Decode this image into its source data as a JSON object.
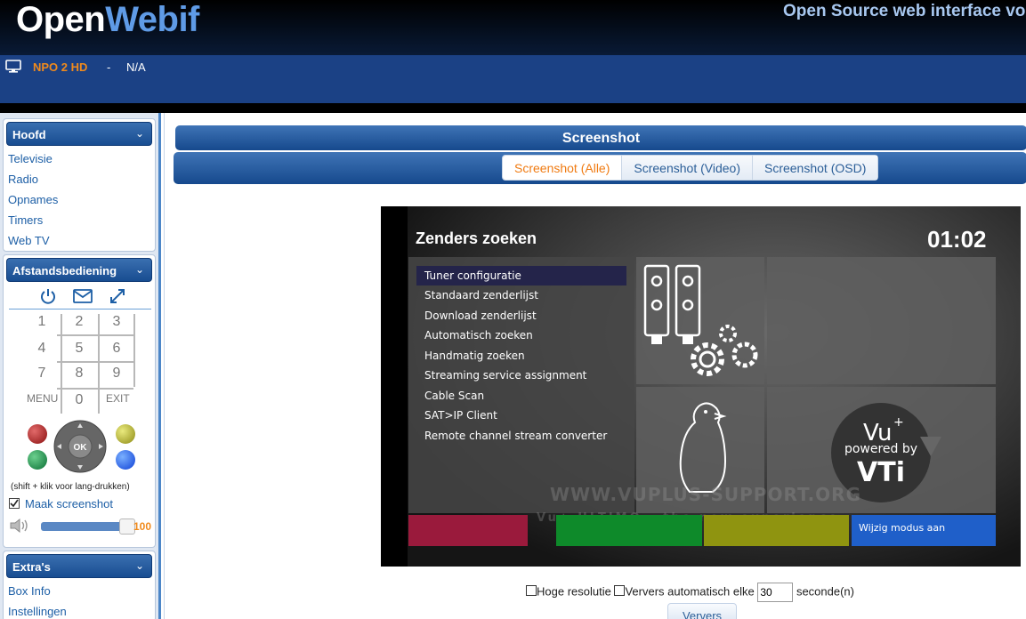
{
  "header": {
    "logo_open": "Open",
    "logo_webif": "Webif",
    "tagline": "Open Source web interface vo"
  },
  "infobar": {
    "channel": "NPO 2 HD",
    "separator": "-",
    "now": "N/A"
  },
  "sidebar": {
    "main_title": "Hoofd",
    "main_items": [
      "Televisie",
      "Radio",
      "Opnames",
      "Timers",
      "Web TV"
    ],
    "remote_title": "Afstandsbediening",
    "keys": [
      "1",
      "2",
      "3",
      "4",
      "5",
      "6",
      "7",
      "8",
      "9",
      "MENU",
      "0",
      "EXIT"
    ],
    "ok_label": "OK",
    "hint": "(shift + klik voor lang-drukken)",
    "screenshot_option": "Maak screenshot",
    "volume": "100",
    "extras_title": "Extra's",
    "extras_items": [
      "Box Info",
      "Instellingen"
    ]
  },
  "main": {
    "title": "Screenshot",
    "tabs": [
      "Screenshot (Alle)",
      "Screenshot (Video)",
      "Screenshot (OSD)"
    ],
    "active_tab": 0
  },
  "osd": {
    "title": "Zenders zoeken",
    "clock": "01:02",
    "menu": [
      "Tuner configuratie",
      "Standaard zenderlijst",
      "Download zenderlijst",
      "Automatisch zoeken",
      "Handmatig zoeken",
      "Streaming service assignment",
      "Cable Scan",
      "SAT>IP Client",
      "Remote channel stream converter"
    ],
    "blue_button": "Wijzig modus aan",
    "logo_vu": "Vu",
    "logo_plus": "+",
    "logo_powered": "powered by",
    "logo_vti": "VTi",
    "watermark": "WWW.VUPLUS-SUPPORT.ORG",
    "watermark2": "Vu+ ULTIMO - the new experience",
    "colors": {
      "red": "#9a1a3c",
      "green": "#0e8a2a",
      "yellow": "#8f9410",
      "blue": "#1f5fc9"
    }
  },
  "options": {
    "hires": "Hoge resolutie",
    "auto": "Ververs automatisch elke",
    "seconds_value": "30",
    "seconds_label": "seconde(n)",
    "refresh": "Ververs"
  }
}
